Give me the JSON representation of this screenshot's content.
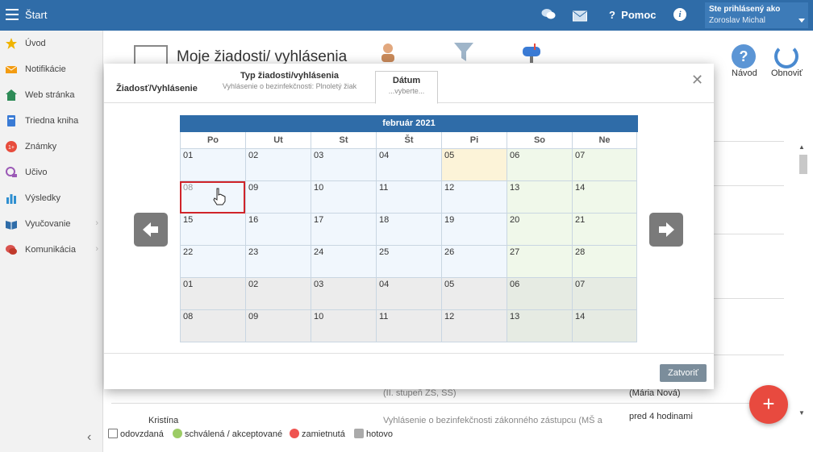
{
  "topbar": {
    "title": "Štart",
    "help_label": "Pomoc",
    "user_label": "Ste prihlásený ako",
    "user_name": "Zoroslav Michal"
  },
  "sidebar": {
    "items": [
      {
        "label": "Úvod",
        "icon": "star-icon",
        "color": "#f0b400"
      },
      {
        "label": "Notifikácie",
        "icon": "envelope-icon",
        "color": "#f39c12"
      },
      {
        "label": "Web stránka",
        "icon": "home-icon",
        "color": "#2e8b57"
      },
      {
        "label": "Triedna kniha",
        "icon": "book-icon",
        "color": "#3a7bd5"
      },
      {
        "label": "Známky",
        "icon": "grades-icon",
        "color": "#e74c3c"
      },
      {
        "label": "Učivo",
        "icon": "curriculum-icon",
        "color": "#9b59b6"
      },
      {
        "label": "Výsledky",
        "icon": "chart-icon",
        "color": "#2f8fd0"
      },
      {
        "label": "Vyučovanie",
        "icon": "open-book-icon",
        "color": "#2f6ca8"
      },
      {
        "label": "Komunikácia",
        "icon": "chat-icon",
        "color": "#d9534f"
      }
    ]
  },
  "page": {
    "title": "Moje žiadosti/ vyhlásenia",
    "help_button": "Návod",
    "refresh_button": "Obnoviť"
  },
  "background": {
    "row1_text": "(II. stupeň ZŠ, SŠ)",
    "row1_right": "(Mária Nová)",
    "row2_name": "Kristína",
    "row2_text": "Vyhlásenie o bezinfekčnosti zákonného zástupcu (MŠ a",
    "row2_right": "pred 4 hodinami"
  },
  "legend": {
    "sent": "odovzdaná",
    "approved": "schválená / akceptované",
    "rejected": "zamietnutá",
    "done": "hotovo"
  },
  "modal": {
    "tab_first": "Žiadosť/Vyhlásenie",
    "tab_type_title": "Typ žiadosti/vyhlásenia",
    "tab_type_value": "Vyhlásenie o bezinfekčnosti: Plnoletý žiak",
    "tab_date_title": "Dátum",
    "tab_date_value": "...vyberte...",
    "close_button": "Zatvoriť",
    "month": "február 2021",
    "days_of_week": [
      "Po",
      "Ut",
      "St",
      "Št",
      "Pi",
      "So",
      "Ne"
    ],
    "weeks": [
      [
        "01",
        "02",
        "03",
        "04",
        "05",
        "06",
        "07"
      ],
      [
        "08",
        "09",
        "10",
        "11",
        "12",
        "13",
        "14"
      ],
      [
        "15",
        "16",
        "17",
        "18",
        "19",
        "20",
        "21"
      ],
      [
        "22",
        "23",
        "24",
        "25",
        "26",
        "27",
        "28"
      ],
      [
        "01",
        "02",
        "03",
        "04",
        "05",
        "06",
        "07"
      ],
      [
        "08",
        "09",
        "10",
        "11",
        "12",
        "13",
        "14"
      ]
    ]
  }
}
